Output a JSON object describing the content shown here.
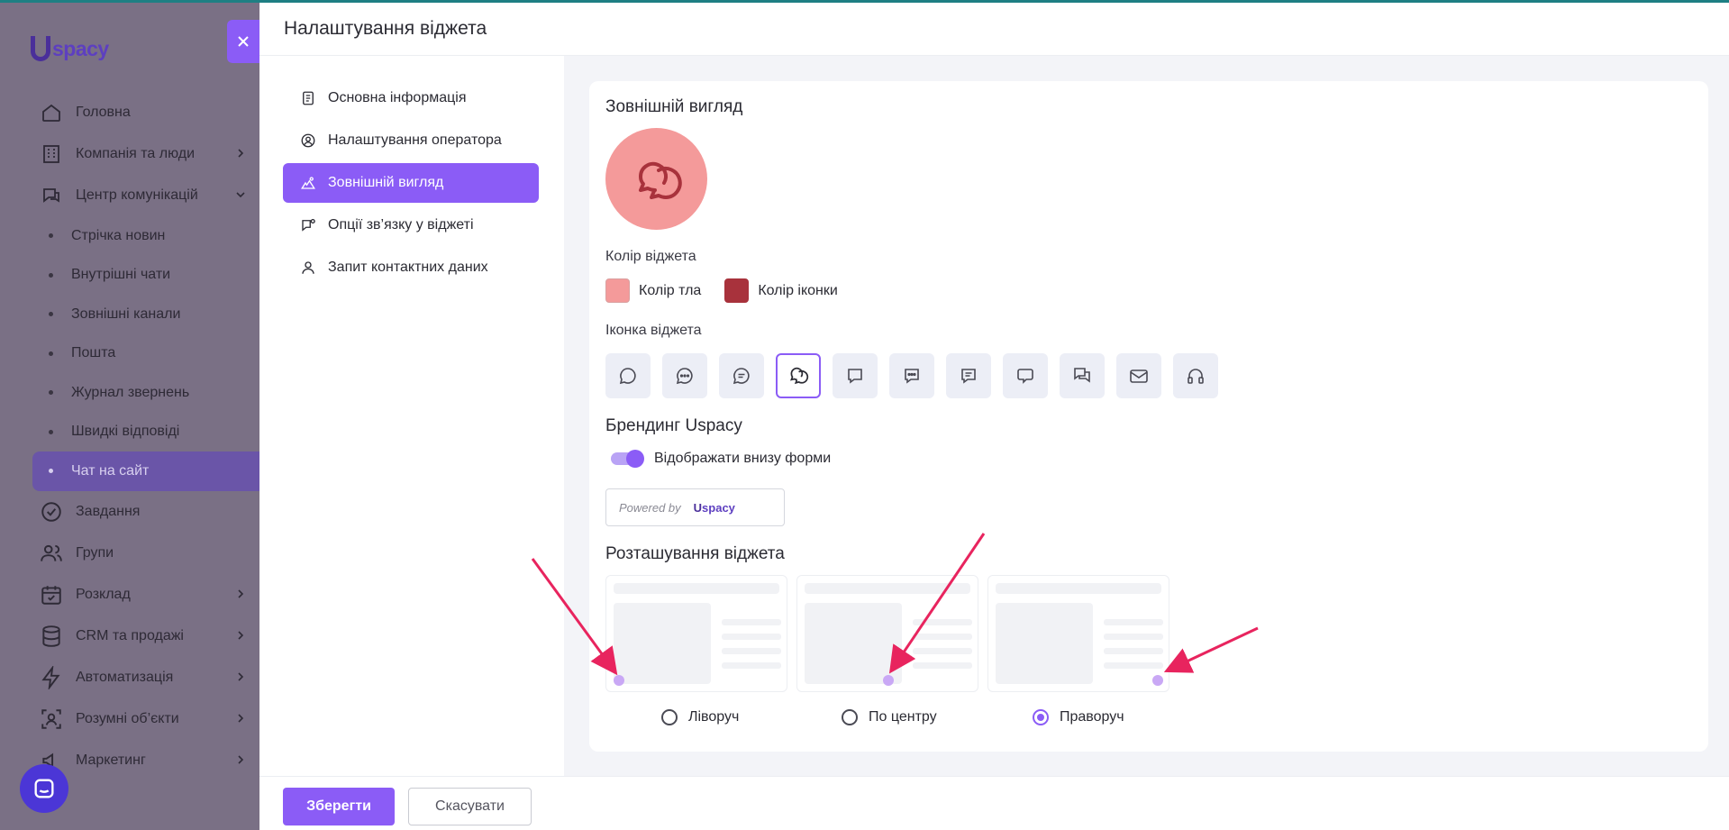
{
  "app": {
    "logo_text": "spacy",
    "nav": [
      {
        "label": "Головна",
        "icon": "home-icon",
        "has_chevron": false
      },
      {
        "label": "Компанія та люди",
        "icon": "building-icon",
        "has_chevron": true
      },
      {
        "label": "Центр комунікацій",
        "icon": "communication-icon",
        "has_chevron": true
      }
    ],
    "sub_nav": [
      {
        "label": "Стрічка новин"
      },
      {
        "label": "Внутрішні чати"
      },
      {
        "label": "Зовнішні канали"
      },
      {
        "label": "Пошта"
      },
      {
        "label": "Журнал звернень"
      },
      {
        "label": "Швидкі відповіді"
      },
      {
        "label": "Чат на сайт",
        "active": true
      }
    ],
    "nav_bottom": [
      {
        "label": "Завдання",
        "icon": "check-circle-icon",
        "has_chevron": false
      },
      {
        "label": "Групи",
        "icon": "users-icon",
        "has_chevron": false
      },
      {
        "label": "Розклад",
        "icon": "calendar-icon",
        "has_chevron": true
      },
      {
        "label": "CRM та продажі",
        "icon": "database-icon",
        "has_chevron": true
      },
      {
        "label": "Автоматизація",
        "icon": "lightning-icon",
        "has_chevron": true
      },
      {
        "label": "Розумні об’єкти",
        "icon": "smart-object-icon",
        "has_chevron": true
      },
      {
        "label": "Маркетинг",
        "icon": "marketing-icon",
        "has_chevron": true
      }
    ]
  },
  "drawer": {
    "title": "Налаштування віджета",
    "menu": [
      {
        "label": "Основна інформація",
        "icon": "document-icon"
      },
      {
        "label": "Налаштування оператора",
        "icon": "user-circle-icon"
      },
      {
        "label": "Зовнішній вигляд",
        "icon": "appearance-icon",
        "active": true
      },
      {
        "label": "Опції зв’язку у віджеті",
        "icon": "chat-settings-icon"
      },
      {
        "label": "Запит контактних даних",
        "icon": "user-icon"
      }
    ]
  },
  "appearance": {
    "title": "Зовнішній вигляд",
    "color_label": "Колір віджета",
    "bg_color_label": "Колір тла",
    "bg_color": "#f49a9a",
    "icon_color_label": "Колір іконки",
    "icon_color": "#a8323c",
    "icon_label": "Іконка віджета",
    "icon_options": [
      "chat-round-icon",
      "chat-dots-icon",
      "chat-lines-icon",
      "chat-double-icon",
      "chat-square-icon",
      "chat-square-dots-icon",
      "chat-square-lines-icon",
      "chat-bubble-icon",
      "chat-multi-icon",
      "mail-icon",
      "headset-icon"
    ],
    "selected_icon_index": 3,
    "branding_title": "Брендинг Uspacy",
    "branding_toggle_label": "Відображати внизу форми",
    "branding_enabled": true,
    "powered_by": "Powered by",
    "powered_logo": "spacy",
    "position_title": "Розташування віджета",
    "positions": [
      {
        "label": "Ліворуч",
        "checked": false
      },
      {
        "label": "По центру",
        "checked": false
      },
      {
        "label": "Праворуч",
        "checked": true
      }
    ]
  },
  "footer": {
    "save_label": "Зберегти",
    "cancel_label": "Скасувати"
  },
  "colors": {
    "accent": "#8b5cf6",
    "annotation_arrow": "#e8245e"
  }
}
